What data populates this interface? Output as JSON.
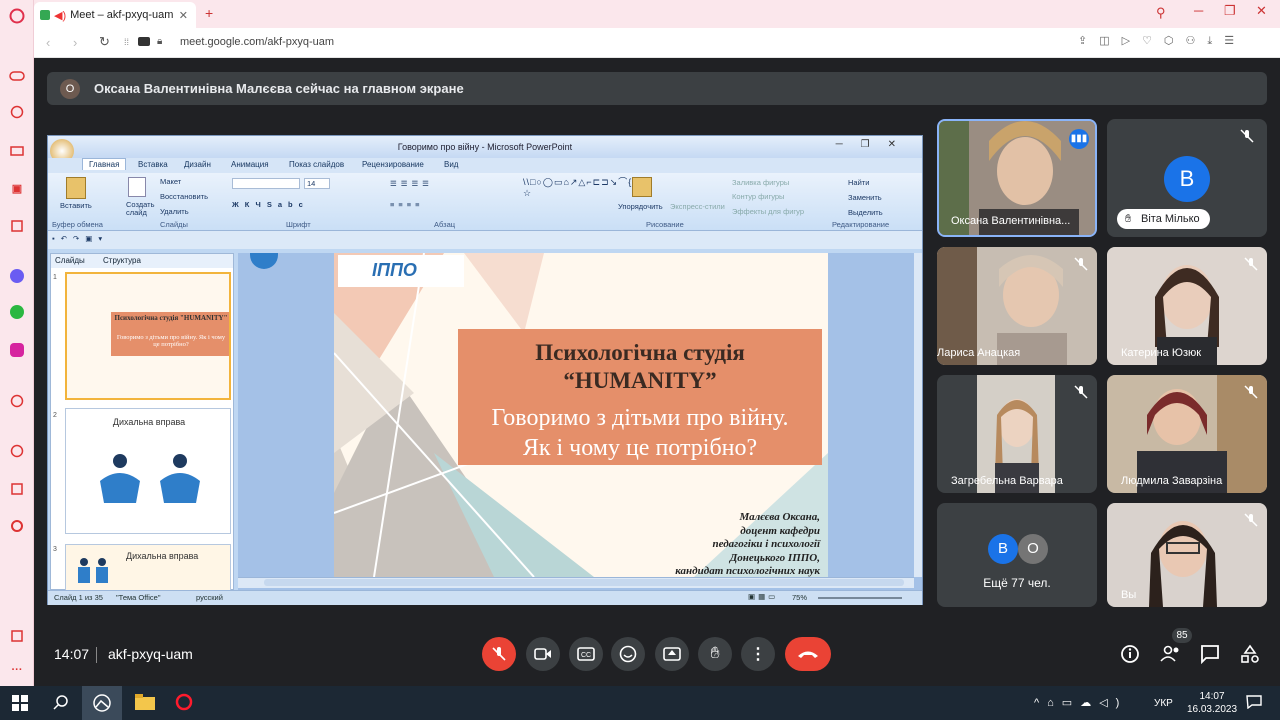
{
  "browser": {
    "tab_title": "Meet – akf-pxyq-uam",
    "url": "meet.google.com/akf-pxyq-uam"
  },
  "banner": {
    "avatar": "О",
    "text": "Оксана Валентинівна Малєєва сейчас на главном экране"
  },
  "ppt": {
    "window_title": "Говоримо про війну - Microsoft PowerPoint",
    "tabs": [
      "Главная",
      "Вставка",
      "Дизайн",
      "Анимация",
      "Показ слайдов",
      "Рецензирование",
      "Вид"
    ],
    "ribbon": {
      "paste": "Вставить",
      "clipboard": "Буфер обмена",
      "create_slide": "Создать слайд",
      "layout": "Макет",
      "restore": "Восстановить",
      "delete": "Удалить",
      "slides": "Слайды",
      "font_size": "14",
      "font": "Шрифт",
      "paragraph": "Абзац",
      "arrange": "Упорядочить",
      "quick_styles": "Экспресс-стили",
      "shape_fill": "Заливка фигуры",
      "shape_outline": "Контур фигуры",
      "shape_effects": "Эффекты для фигур",
      "drawing": "Рисование",
      "find": "Найти",
      "replace": "Заменить",
      "select": "Выделить",
      "editing": "Редактирование"
    },
    "pane_tabs": [
      "Слайды",
      "Структура"
    ],
    "thumbs": [
      {
        "num": "1",
        "title": "Психологічна студія \"HUMANITY\"",
        "sub": "Говоримо з дітьми про війну. Як і чому це потрібно?"
      },
      {
        "num": "2",
        "title": "Дихальна вправа"
      },
      {
        "num": "3",
        "title": "Дихальна вправа"
      }
    ],
    "slide": {
      "logo": "ІППО",
      "title1": "Психологічна студія",
      "title2": "“HUMANITY”",
      "subtitle1": "Говоримо з дітьми про війну.",
      "subtitle2": "Як і чому це потрібно?",
      "author": [
        "Малєєва Оксана,",
        "доцент кафедри",
        "педагогіки і психології",
        "Донецького ІППО,",
        "кандидат психологічних наук"
      ]
    },
    "status": {
      "slide": "Слайд 1 из 35",
      "theme": "\"Тема Office\"",
      "lang": "русский",
      "zoom": "75%"
    }
  },
  "participants": [
    {
      "name": "Оксана Валентинівна...",
      "speaking": true
    },
    {
      "name": "Віта Мілько",
      "initial": "В"
    },
    {
      "name": "Лариса Анацкая"
    },
    {
      "name": "Катерина Юзюк"
    },
    {
      "name": "Загребельна Варвара"
    },
    {
      "name": "Людмила Заварзіна"
    },
    {
      "name": "Ещё 77 чел.",
      "initials": [
        "В",
        "О"
      ]
    },
    {
      "name": "Вы"
    }
  ],
  "bottom": {
    "time": "14:07",
    "meeting": "akf-pxyq-uam",
    "people_count": "85"
  },
  "taskbar": {
    "lang": "УКР",
    "time": "14:07",
    "date": "16.03.2023"
  },
  "colors": {
    "meet_bg": "#202124",
    "tile": "#3c4043",
    "end_call": "#ea4335",
    "accent": "#8ab4f8"
  }
}
